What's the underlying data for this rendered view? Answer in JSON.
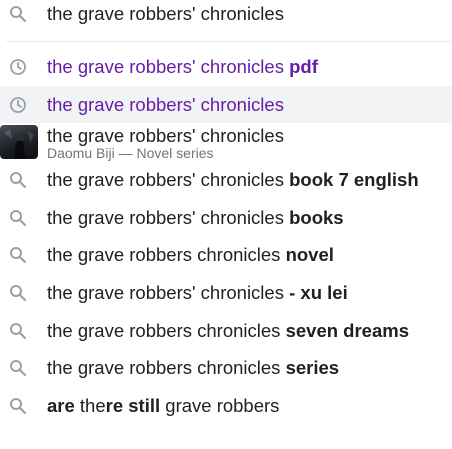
{
  "search": {
    "query": "the grave robbers' chronicles"
  },
  "suggestions": [
    {
      "type": "history",
      "visited": true,
      "highlight": false,
      "text": "the grave robbers' chronicles",
      "bold": " pdf",
      "icon": "clock-icon"
    },
    {
      "type": "history",
      "visited": true,
      "highlight": true,
      "text": "the grave robbers' chronicles",
      "bold": "",
      "icon": "clock-icon"
    },
    {
      "type": "entity",
      "text": "the grave robbers' chronicles",
      "subtitle": "Daomu Biji — Novel series",
      "icon": "book-cover-thumbnail"
    },
    {
      "type": "search",
      "text": "the grave robbers' chronicles",
      "bold": " book 7 english",
      "icon": "search-icon"
    },
    {
      "type": "search",
      "text": "the grave robbers' chronicles",
      "bold": " books",
      "icon": "search-icon"
    },
    {
      "type": "search",
      "text": "the grave robbers chronicles",
      "bold": " novel",
      "icon": "search-icon"
    },
    {
      "type": "search",
      "text": "the grave robbers' chronicles",
      "bold": " - xu lei",
      "icon": "search-icon"
    },
    {
      "type": "search",
      "text": "the grave robbers chronicles",
      "bold": " seven dreams",
      "icon": "search-icon"
    },
    {
      "type": "search",
      "text": "the grave robbers chronicles",
      "bold": " series",
      "icon": "search-icon"
    },
    {
      "type": "search-mixed",
      "parts": [
        {
          "t": "are",
          "b": true
        },
        {
          "t": " the",
          "b": false
        },
        {
          "t": "re still",
          "b": true
        },
        {
          "t": " grave robbers",
          "b": false
        }
      ],
      "icon": "search-icon"
    }
  ],
  "colors": {
    "text": "#202124",
    "visited": "#681da8",
    "icon": "#9aa0a6",
    "highlight_bg": "#f1f3f4",
    "subtitle": "#70757a"
  }
}
